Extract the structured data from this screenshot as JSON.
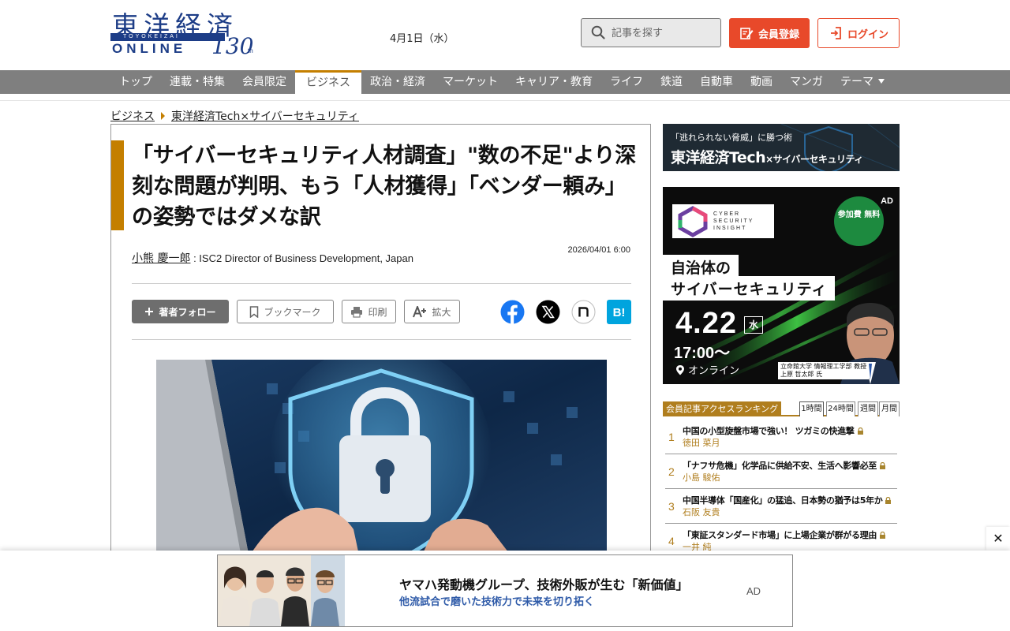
{
  "header": {
    "logo_kanji": "東洋経済",
    "logo_sub": "TOYOKEIZAI",
    "logo_online": "ONLINE",
    "logo_anniv": "130",
    "logo_anniv_suffix": "th",
    "date": "4月1日（水）",
    "search_placeholder": "記事を探す",
    "member_label": "会員登録",
    "login_label": "ログイン"
  },
  "nav": {
    "items": [
      "トップ",
      "連載・特集",
      "会員限定",
      "ビジネス",
      "政治・経済",
      "マーケット",
      "キャリア・教育",
      "ライフ",
      "鉄道",
      "自動車",
      "動画",
      "マンガ",
      "テーマ"
    ],
    "active_index": 3
  },
  "breadcrumb": [
    "ビジネス",
    "東洋経済Tech×サイバーセキュリティ"
  ],
  "article": {
    "title": "「サイバーセキュリティ人材調査」\"数の不足\"より深刻な問題が判明、もう「人材獲得」「ベンダー頼み」の姿勢ではダメな訳",
    "author_name": "小熊 慶一郎",
    "author_role": " : ISC2 Director of Business Development, Japan",
    "date": "2026/04/01 6:00",
    "follow_label": "著者フォロー",
    "bookmark_label": "ブックマーク",
    "print_label": "印刷",
    "zoom_label": "拡大"
  },
  "sidebar": {
    "banner1_line1": "「逃れられない脅威」に勝つ術",
    "banner1_brand": "東洋経済Tech",
    "banner1_suffix": "×サイバーセキュリティ",
    "ad": {
      "tag": "AD",
      "logo_text": "CYBER SECURITY INSIGHT",
      "fee": "参加費 無料",
      "headline1": "自治体の",
      "headline2": "サイバーセキュリティ",
      "date": "4.22",
      "dow": "水",
      "time": "17:00〜",
      "venue": "オンライン",
      "caption_line1": "立命館大学 情報理工学部 教授",
      "caption_line2": "上原 哲太郎 氏"
    },
    "ranking": {
      "title": "会員記事アクセスランキング",
      "tabs": [
        "1時間",
        "24時間",
        "週間",
        "月間"
      ],
      "active_tab": 0,
      "items": [
        {
          "rank": "1",
          "title": "中国の小型旋盤市場で強い！ ツガミの快進撃",
          "author": "徳田 菜月"
        },
        {
          "rank": "2",
          "title": "「ナフサ危機」化学品に供給不安、生活へ影響必至",
          "author": "小島 駿佑"
        },
        {
          "rank": "3",
          "title": "中国半導体「国産化」の猛追、日本勢の猶予は5年か",
          "author": "石阪 友貴"
        },
        {
          "rank": "4",
          "title": "「東証スタンダード市場」に上場企業が群がる理由",
          "author": "一井 純"
        }
      ]
    }
  },
  "bottom_ad": {
    "title": "ヤマハ発動機グループ、技術外販が生む「新価値」",
    "subtitle": "他流試合で磨いた技術力で未来を切り拓く",
    "tag": "AD",
    "close": "✕"
  },
  "colors": {
    "accent": "#c47f00",
    "brand_blue": "#1d3d87",
    "nav_bg": "#7f7f7f",
    "member_red": "#e8492a",
    "ranking_gold": "#b07e1e"
  }
}
